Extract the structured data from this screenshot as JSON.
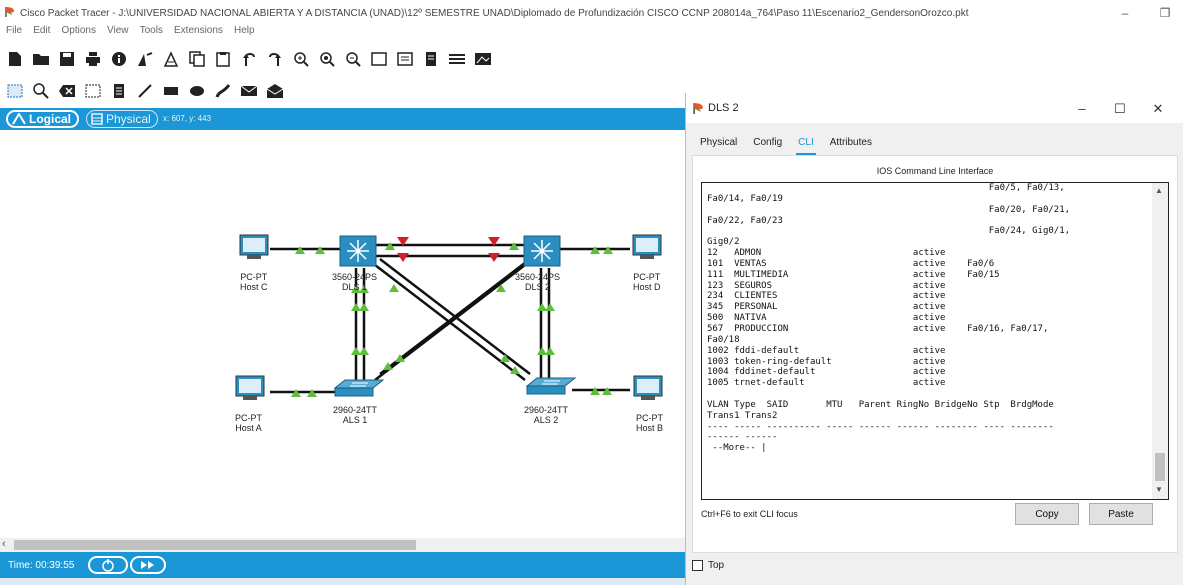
{
  "window": {
    "title": "Cisco Packet Tracer - J:\\UNIVERSIDAD NACIONAL ABIERTA Y A DISTANCIA (UNAD)\\12º SEMESTRE UNAD\\Diplomado de Profundización CISCO CCNP 208014a_764\\Paso 11\\Escenario2_GendersonOrozco.pkt",
    "minimize": "–",
    "maximize": "❐"
  },
  "menu": [
    "File",
    "Edit",
    "Options",
    "View",
    "Tools",
    "Extensions",
    "Help"
  ],
  "workspace": {
    "logical_tab": "Logical",
    "physical_tab": "Physical",
    "coords": "x: 607, y: 443",
    "time": "Time: 00:39:55"
  },
  "devices": {
    "host_c": {
      "type": "PC-PT",
      "name": "Host C"
    },
    "host_d": {
      "type": "PC-PT",
      "name": "Host D"
    },
    "host_a": {
      "type": "PC-PT",
      "name": "Host A"
    },
    "host_b": {
      "type": "PC-PT",
      "name": "Host B"
    },
    "dls1": {
      "type": "3560-24PS",
      "name": "DLS 1"
    },
    "dls2": {
      "type": "3560-24PS",
      "name": "DLS 2"
    },
    "als1": {
      "type": "2960-24TT",
      "name": "ALS 1"
    },
    "als2": {
      "type": "2960-24TT",
      "name": "ALS 2"
    }
  },
  "dls_window": {
    "title": "DLS 2",
    "tabs": [
      "Physical",
      "Config",
      "CLI",
      "Attributes"
    ],
    "active_tab": "CLI",
    "heading": "IOS Command Line Interface",
    "cli_text": "                                                    Fa0/5, Fa0/13,\nFa0/14, Fa0/19\n                                                    Fa0/20, Fa0/21,\nFa0/22, Fa0/23\n                                                    Fa0/24, Gig0/1,\nGig0/2\n12   ADMON                            active\n101  VENTAS                           active    Fa0/6\n111  MULTIMEDIA                       active    Fa0/15\n123  SEGUROS                          active\n234  CLIENTES                         active\n345  PERSONAL                         active\n500  NATIVA                           active\n567  PRODUCCION                       active    Fa0/16, Fa0/17,\nFa0/18\n1002 fddi-default                     active\n1003 token-ring-default               active\n1004 fddinet-default                  active\n1005 trnet-default                    active\n\nVLAN Type  SAID       MTU   Parent RingNo BridgeNo Stp  BrdgMode\nTrans1 Trans2\n---- ----- ---------- ----- ------ ------ -------- ---- --------\n------ ------\n --More-- |",
    "hint": "Ctrl+F6 to exit CLI focus",
    "copy_button": "Copy",
    "paste_button": "Paste",
    "top_checkbox": "Top"
  },
  "colors": {
    "accent": "#1b96d6",
    "link_up": "#5bbf3a",
    "link_down": "#d0202a",
    "switch": "#2a8fc0"
  }
}
